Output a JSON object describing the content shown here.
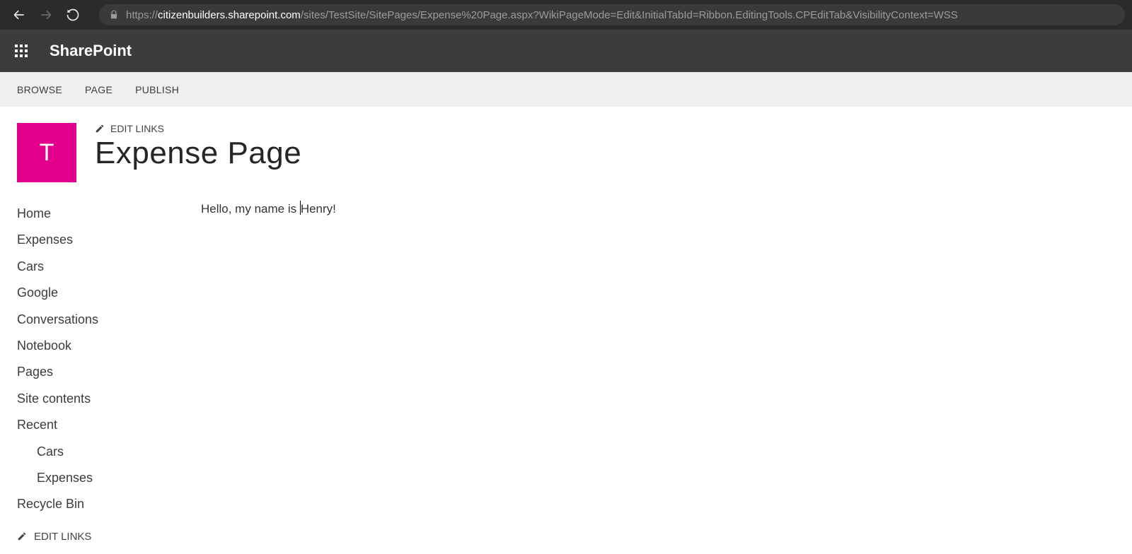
{
  "browser": {
    "url_prefix": "https://",
    "url_host": "citizenbuilders.sharepoint.com",
    "url_path": "/sites/TestSite/SitePages/Expense%20Page.aspx?WikiPageMode=Edit&InitialTabId=Ribbon.EditingTools.CPEditTab&VisibilityContext=WSS"
  },
  "suite": {
    "brand": "SharePoint"
  },
  "ribbon": {
    "tabs": [
      "BROWSE",
      "PAGE",
      "PUBLISH"
    ]
  },
  "header": {
    "logo_letter": "T",
    "edit_links_label": "EDIT LINKS",
    "page_title": "Expense Page"
  },
  "nav": {
    "items": [
      {
        "label": "Home"
      },
      {
        "label": "Expenses"
      },
      {
        "label": "Cars"
      },
      {
        "label": "Google"
      },
      {
        "label": "Conversations"
      },
      {
        "label": "Notebook"
      },
      {
        "label": "Pages"
      },
      {
        "label": "Site contents"
      },
      {
        "label": "Recent"
      },
      {
        "label": "Cars",
        "sub": true
      },
      {
        "label": "Expenses",
        "sub": true
      },
      {
        "label": "Recycle Bin"
      }
    ],
    "edit_links_label": "EDIT LINKS"
  },
  "content": {
    "text_before": "Hello, my name is ",
    "text_after": "Henry!"
  }
}
